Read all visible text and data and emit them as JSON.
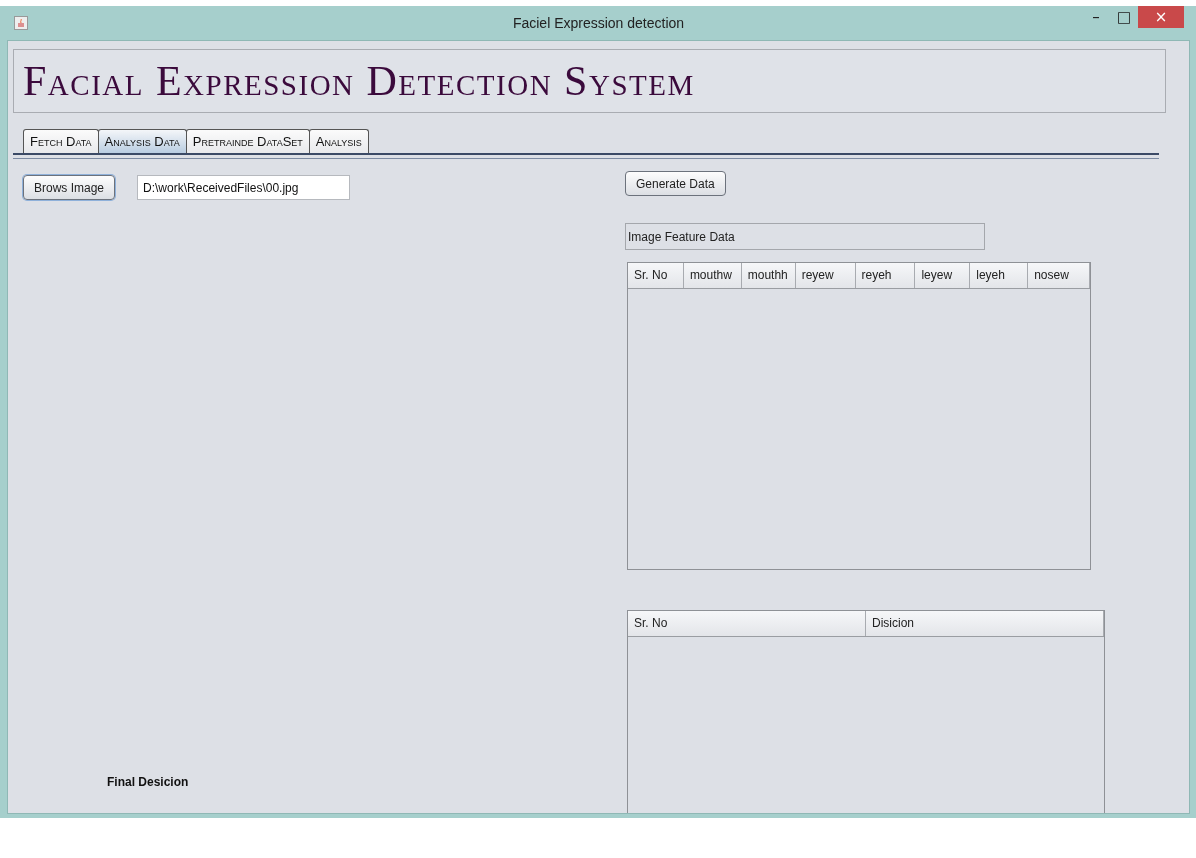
{
  "window": {
    "title": "Faciel Expression detection",
    "controls": [
      "–",
      "□",
      "×"
    ]
  },
  "heading": "Facial Expression Detection System",
  "tabs": [
    {
      "label": "Fetch Data",
      "selected": false
    },
    {
      "label": "Analysis Data",
      "selected": true
    },
    {
      "label": "Pretrainde DataSet",
      "selected": false
    },
    {
      "label": "Analysis",
      "selected": false
    }
  ],
  "browse_button": "Brows Image",
  "image_path": {
    "value": "D:\\work\\ReceivedFiles\\00.jpg"
  },
  "final_decision_label": "Final Desicion",
  "generate_button": "Generate Data",
  "feature_label": "Image Feature Data",
  "feature_table": {
    "columns": [
      "Sr. No",
      "mouthw",
      "mouthh",
      "reyew",
      "reyeh",
      "leyew",
      "leyeh",
      "nosew"
    ]
  },
  "decision_table": {
    "columns": [
      "Sr. No",
      "Disicion"
    ]
  }
}
